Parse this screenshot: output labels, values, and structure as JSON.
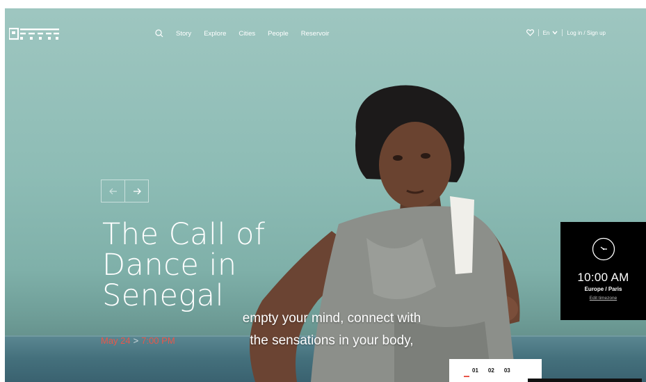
{
  "header": {
    "nav_items": [
      "Story",
      "Explore",
      "Cities",
      "People",
      "Reservoir"
    ],
    "language": "En",
    "auth": "Log in / Sign up"
  },
  "hero": {
    "title_lines": [
      "The Call of",
      "Dance in",
      "Senegal"
    ],
    "date": "May 24",
    "time": "7:00 PM",
    "subtitle_lines": [
      "empty your mind, connect with",
      "the sensations in your body,"
    ]
  },
  "clock": {
    "time": "10:00 AM",
    "zone": "Europe / Paris",
    "edit": "Edit timezone"
  },
  "pager": [
    "01",
    "02",
    "03"
  ],
  "colors": {
    "accent": "#e8574a",
    "sky": "#9ec6c0",
    "widget_bg": "#000000"
  },
  "icons": [
    "logo-icon",
    "search-icon",
    "heart-icon",
    "chevron-down-icon",
    "arrow-left-icon",
    "arrow-right-icon",
    "clock-icon"
  ]
}
